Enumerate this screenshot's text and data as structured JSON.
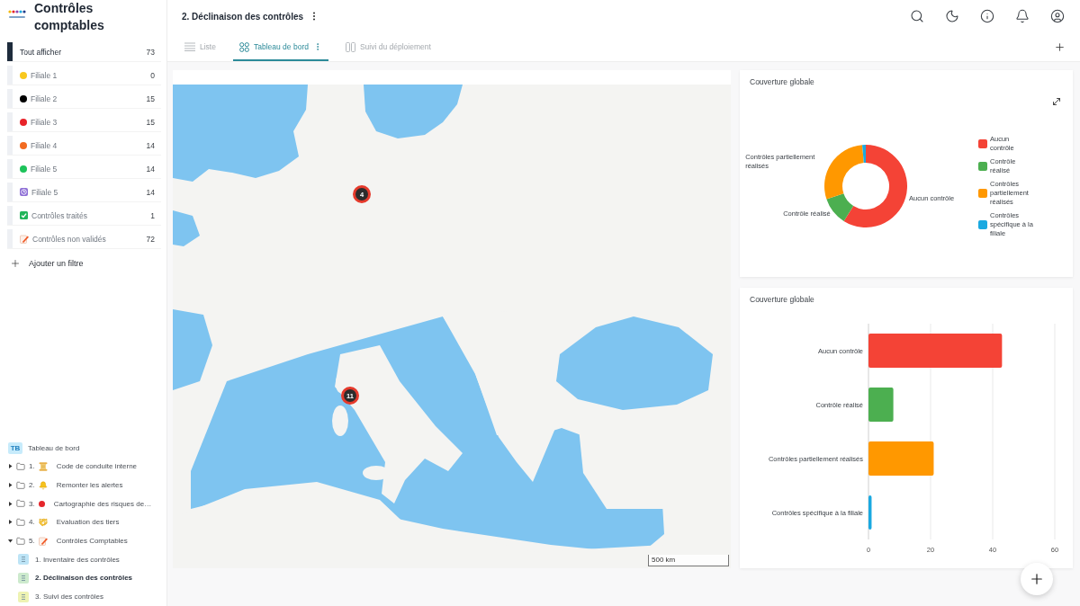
{
  "sidebar": {
    "title": "Contrôles comptables",
    "filters": [
      {
        "label": "Tout afficher",
        "count": "73",
        "selected": true,
        "kind": "none"
      },
      {
        "label": "Filiale 1",
        "count": "0",
        "selected": false,
        "kind": "dot",
        "color": "#f8c81e"
      },
      {
        "label": "Filiale 2",
        "count": "15",
        "selected": false,
        "kind": "dot",
        "color": "#000000"
      },
      {
        "label": "Filiale 3",
        "count": "15",
        "selected": false,
        "kind": "dot",
        "color": "#e8232a"
      },
      {
        "label": "Filiale 4",
        "count": "14",
        "selected": false,
        "kind": "dot",
        "color": "#f26b21"
      },
      {
        "label": "Filiale 5",
        "count": "14",
        "selected": false,
        "kind": "dot",
        "color": "#1dc35a"
      },
      {
        "label": "Filiale 5",
        "count": "14",
        "selected": false,
        "kind": "clock"
      },
      {
        "label": "Contrôles traités",
        "count": "1",
        "selected": false,
        "kind": "check"
      },
      {
        "label": "Contrôles non validés",
        "count": "72",
        "selected": false,
        "kind": "memo"
      }
    ],
    "add_filter": "Ajouter un filtre",
    "tree": [
      {
        "kind": "dashboard",
        "badge": "TB",
        "label": "Tableau de bord"
      },
      {
        "kind": "scroll",
        "number": "1.",
        "label": "Code de conduite interne",
        "expanded": false
      },
      {
        "kind": "bell",
        "number": "2.",
        "label": "Remonter les alertes",
        "expanded": false
      },
      {
        "kind": "dot",
        "number": "3.",
        "label": "Cartographie des risques de…",
        "expanded": false
      },
      {
        "kind": "handshake",
        "number": "4.",
        "label": "Evaluation des tiers",
        "expanded": false
      },
      {
        "kind": "memo",
        "number": "5.",
        "label": "Contrôles Comptables",
        "expanded": true,
        "children": [
          {
            "label": "1. Inventaire des contrôles",
            "color": "#bde4f6",
            "selected": false
          },
          {
            "label": "2. Déclinaison des contrôles",
            "color": "#cdeacd",
            "selected": true
          },
          {
            "label": "3. Suivi des contrôles",
            "color": "#eef3b3",
            "selected": false
          }
        ]
      }
    ]
  },
  "header": {
    "title": "2. Déclinaison des contrôles"
  },
  "tabs": [
    {
      "label": "Liste",
      "selected": false,
      "kind": "list"
    },
    {
      "label": "Tableau de bord",
      "selected": true,
      "kind": "grid"
    },
    {
      "label": "Suivi du déploiement",
      "selected": false,
      "kind": "columns"
    }
  ],
  "map": {
    "markers": [
      {
        "count": "4"
      },
      {
        "count": "11"
      }
    ],
    "scale": "500 km"
  },
  "donut_card": {
    "chart_data": {
      "type": "donut",
      "title": "Couverture globale",
      "categories": [
        "Aucun contrôle",
        "Contrôle réalisé",
        "Contrôles partiellement réalisés",
        "Contrôles spécifique à la filiale"
      ],
      "values": [
        58.9,
        10.96,
        28.77,
        1.37
      ],
      "colors": [
        "#f44336",
        "#4caf50",
        "#ff9800",
        "#1aa9e1"
      ],
      "legend": "right"
    }
  },
  "bar_card": {
    "chart_data": {
      "type": "bar",
      "title": "Couverture globale",
      "orientation": "horizontal",
      "categories": [
        "Aucun contrôle",
        "Contrôle réalisé",
        "Contrôles partiellement réalisés",
        "Contrôles spécifique à la filiale"
      ],
      "values": [
        43,
        8,
        21,
        1
      ],
      "colors": [
        "#f44336",
        "#4caf50",
        "#ff9800",
        "#1aa9e1"
      ],
      "xlim": [
        0,
        60
      ],
      "xticks": [
        0,
        20,
        40,
        60
      ]
    }
  }
}
